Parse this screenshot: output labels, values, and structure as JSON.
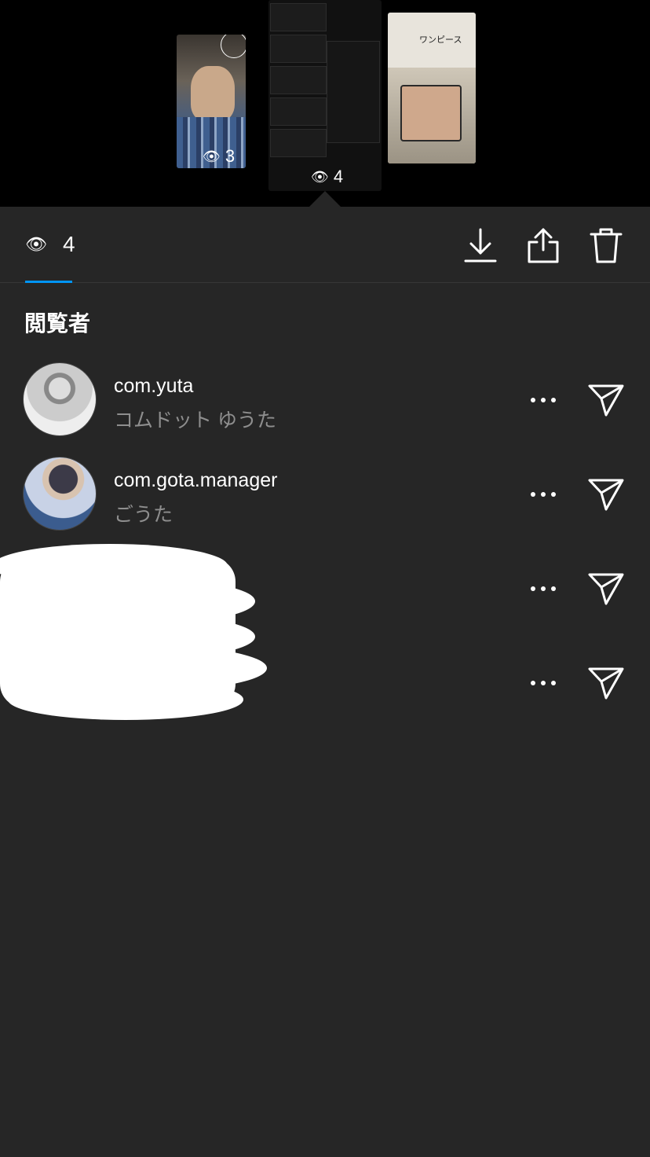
{
  "stories": {
    "left_view_count": "3",
    "center_view_count": "4",
    "right_caption": "ワンピース"
  },
  "toolbar": {
    "view_count": "4",
    "active_tab_color": "#0095f6"
  },
  "section_title": "閲覧者",
  "viewers": [
    {
      "username": "com.yuta",
      "fullname": "コムドット ゆうた"
    },
    {
      "username": "com.gota.manager",
      "fullname": "ごうた"
    },
    {
      "username": "",
      "fullname": ""
    },
    {
      "username": "",
      "fullname": ""
    }
  ],
  "icons": {
    "eye": "eye-icon",
    "download": "download-icon",
    "share": "share-icon",
    "delete": "trash-icon",
    "more": "more-icon",
    "send": "send-icon"
  }
}
